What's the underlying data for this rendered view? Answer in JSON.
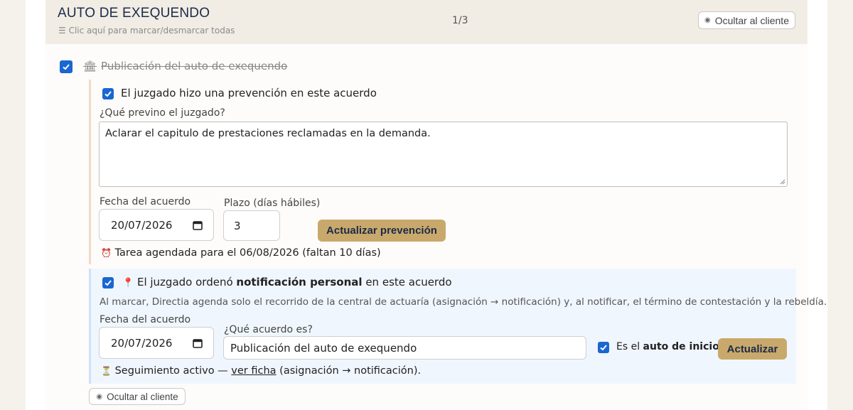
{
  "header": {
    "title": "AUTO DE EXEQUENDO",
    "subtitle_icon": "☰",
    "subtitle": "Clic aquí para marcar/desmarcar todas",
    "counter": "1/3",
    "hide_button": "Ocultar al cliente"
  },
  "main_item": {
    "checked": true,
    "icon": "🏛",
    "label": "Publicación del auto de exequendo"
  },
  "prevention": {
    "checkbox_label": "El juzgado hizo una prevención en este acuerdo",
    "question": "¿Qué previno el juzgado?",
    "answer": "Aclarar el capitulo de prestaciones reclamadas en la demanda.",
    "date_label": "Fecha del acuerdo",
    "date_value": "20/07/2026",
    "term_label": "Plazo (días hábiles)",
    "term_value": "3",
    "update_button": "Actualizar prevención",
    "task_icon": "⏰",
    "task_text": "Tarea agendada para el 06/08/2026 (faltan 10 días)"
  },
  "notification": {
    "pin_icon": "📍",
    "label_pre": "El juzgado ordenó ",
    "label_bold": "notificación personal",
    "label_post": " en este acuerdo",
    "note": "Al marcar, Directia agenda solo el recorrido de la central de actuaría (asignación → notificación) y, al notificar, el término de contestación y la rebeldía.",
    "date_label": "Fecha del acuerdo",
    "date_value": "20/07/2026",
    "which_label": "¿Qué acuerdo es?",
    "which_value": "Publicación del auto de exequendo",
    "inicio_pre": "Es el ",
    "inicio_bold": "auto de inicio",
    "update_button": "Actualizar",
    "follow_icon": "⏳",
    "follow_text": "Seguimiento activo — ",
    "follow_link": "ver ficha",
    "follow_post": " (asignación → notificación)."
  },
  "footer": {
    "hide_button": "Ocultar al cliente"
  }
}
